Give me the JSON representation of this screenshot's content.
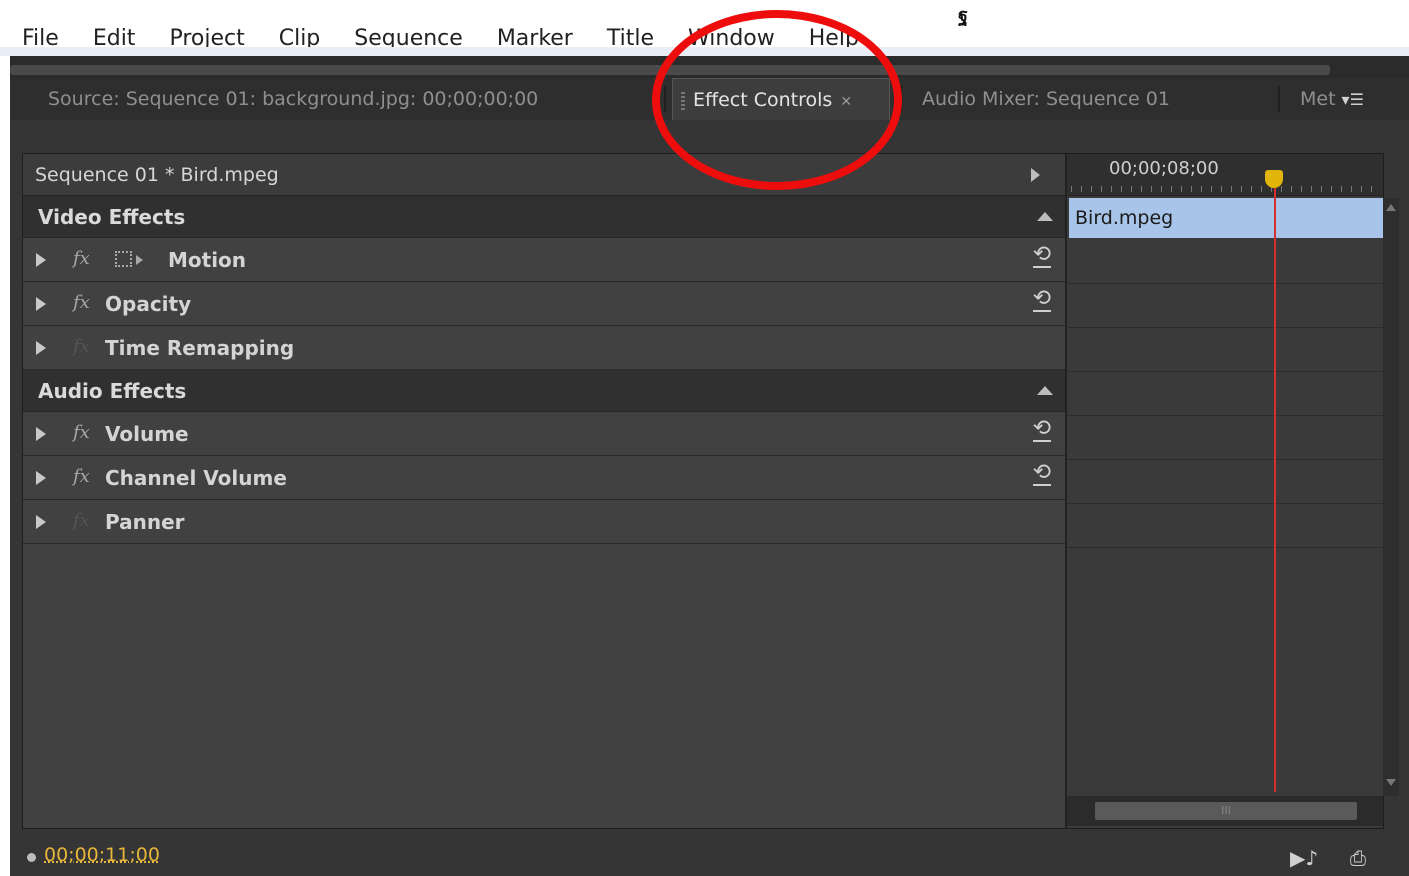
{
  "menu": {
    "items": [
      "File",
      "Edit",
      "Project",
      "Clip",
      "Sequence",
      "Marker",
      "Title",
      "Window",
      "Help"
    ],
    "corner_glyph": "ฐ"
  },
  "tabs": {
    "source": "Source: Sequence 01: background.jpg: 00;00;00;00",
    "effect_controls": "Effect Controls",
    "audio_mixer": "Audio Mixer: Sequence 01",
    "metadata": "Met"
  },
  "effect_controls": {
    "sequence_label": "Sequence 01 * Bird.mpeg",
    "video_section": "Video Effects",
    "video_effects": [
      "Motion",
      "Opacity",
      "Time Remapping"
    ],
    "audio_section": "Audio Effects",
    "audio_effects": [
      "Volume",
      "Channel Volume",
      "Panner"
    ],
    "fx_glyph": "fx",
    "reset_glyph": "⟲"
  },
  "timeline": {
    "ruler_time": "00;00;08;00",
    "clip_name": "Bird.mpeg",
    "scroll_grip": "III"
  },
  "status": {
    "current_time": "00;00;11;00"
  },
  "colors": {
    "highlight_circle": "#ee0d0d",
    "timecode": "#e7b53a",
    "playhead": "#e0b40a",
    "clip": "#a8c4e8",
    "cti_line": "#d23030"
  }
}
